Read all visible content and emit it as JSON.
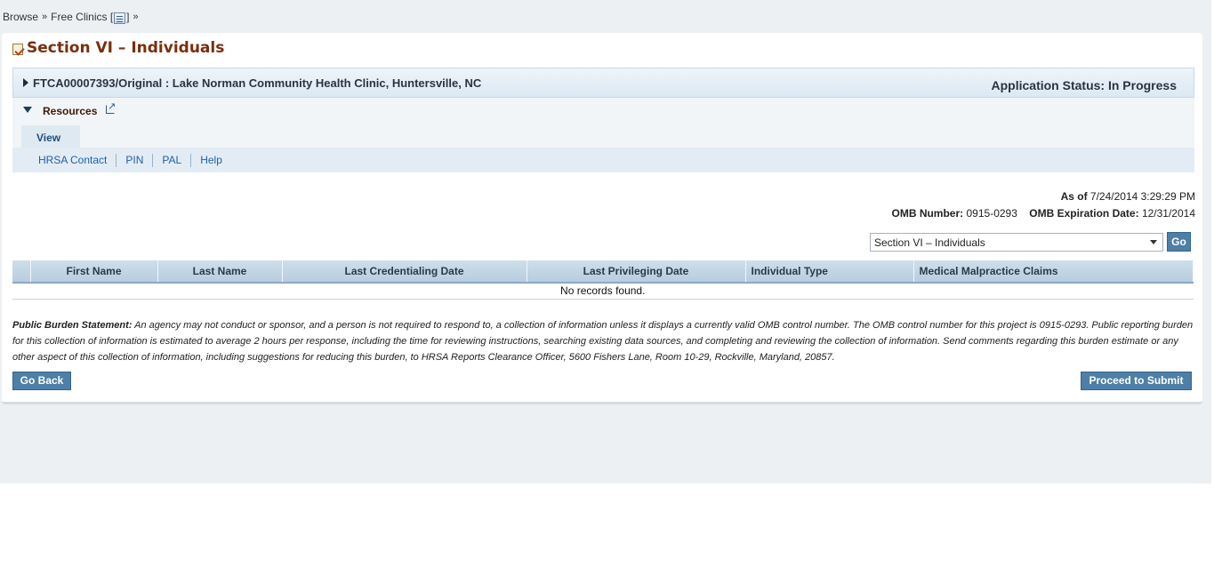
{
  "breadcrumb": {
    "items": [
      "Browse",
      "Free Clinics ["
    ],
    "tail": "]",
    "separator": "»"
  },
  "page": {
    "title": "Section VI – Individuals"
  },
  "app": {
    "id_line": "FTCA00007393/Original : Lake Norman Community Health Clinic, Huntersville, NC",
    "status": "Application Status: In Progress"
  },
  "resources": {
    "label": "Resources",
    "tab": "View",
    "links": [
      "HRSA Contact",
      "PIN",
      "PAL",
      "Help"
    ]
  },
  "meta": {
    "as_of_label": "As of",
    "as_of_value": "7/24/2014 3:29:29 PM",
    "omb_number_label": "OMB Number:",
    "omb_number_value": "0915-0293",
    "omb_exp_label": "OMB Expiration Date:",
    "omb_exp_value": "12/31/2014"
  },
  "section_select": {
    "value": "Section VI – Individuals",
    "go_label": "Go"
  },
  "table": {
    "columns": [
      "",
      "First Name",
      "Last Name",
      "Last Credentialing Date",
      "Last Privileging Date",
      "Individual Type",
      "Medical Malpractice Claims"
    ],
    "empty_message": "No records found."
  },
  "burden": {
    "label": "Public Burden Statement:",
    "text": " An agency may not conduct or sponsor, and a person is not required to respond to, a collection of information unless it displays a currently valid OMB control number. The OMB control number for this project is 0915-0293. Public reporting burden for this collection of information is estimated to average 2 hours per response, including the time for reviewing instructions, searching existing data sources, and completing and reviewing the collection of information. Send comments regarding this burden estimate or any other aspect of this collection of information, including suggestions for reducing this burden, to HRSA Reports Clearance Officer, 5600 Fishers Lane, Room 10-29, Rockville, Maryland, 20857."
  },
  "actions": {
    "back_label": "Go Back",
    "submit_label": "Proceed to Submit"
  }
}
